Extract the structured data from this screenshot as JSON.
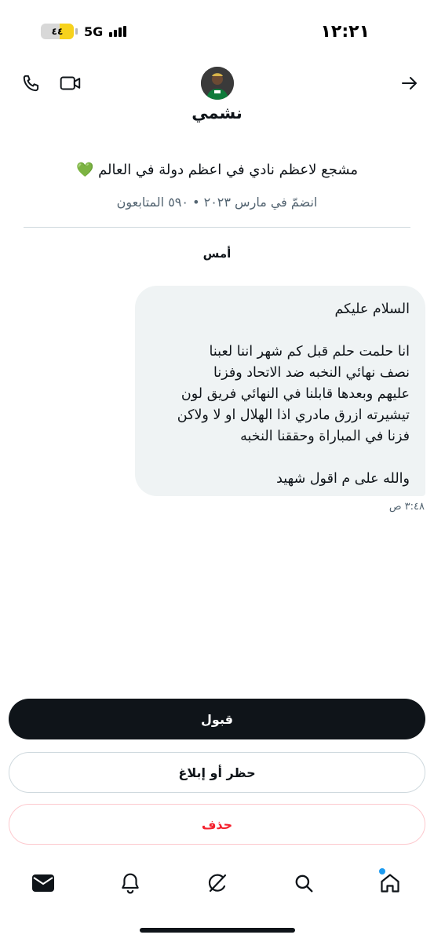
{
  "status_bar": {
    "battery": "٤٤",
    "battery_level": 0.44,
    "network": "5G",
    "time": "١٢:٢١"
  },
  "header": {
    "name": "نشمي",
    "bio": "مشجع لاعظم نادي في اعظم دولة في العالم 💚",
    "meta": "انضمّ في مارس ٢٠٢٣ • ٥٩٠ المتابعون"
  },
  "conversation": {
    "date_label": "أمس",
    "message": {
      "greeting": "السلام عليكم",
      "lines": [
        "انا حلمت حلم قبل كم شهر اننا لعبنا",
        "نصف نهائي النخبه ضد الاتحاد وفزنا",
        "عليهم وبعدها قابلنا في النهائي فريق لون",
        "تيشيرته ازرق مادري اذا الهلال او لا ولاكن",
        "فزنا في المباراة وحققنا النخبه"
      ],
      "closing": "والله على م اقول شهيد",
      "time": "٣:٤٨ ص"
    }
  },
  "actions": {
    "accept": "قبول",
    "block_report": "حظر أو إبلاغ",
    "delete": "حذف"
  },
  "nav": {
    "items": [
      "messages-icon",
      "bell-icon",
      "grok-icon",
      "search-icon",
      "home-icon"
    ],
    "notification_dot_color": "#1d9bf0"
  },
  "colors": {
    "primary": "#0f1419",
    "secondary_text": "#536471",
    "bubble_bg": "#eff3f4",
    "danger": "#f4212e"
  }
}
